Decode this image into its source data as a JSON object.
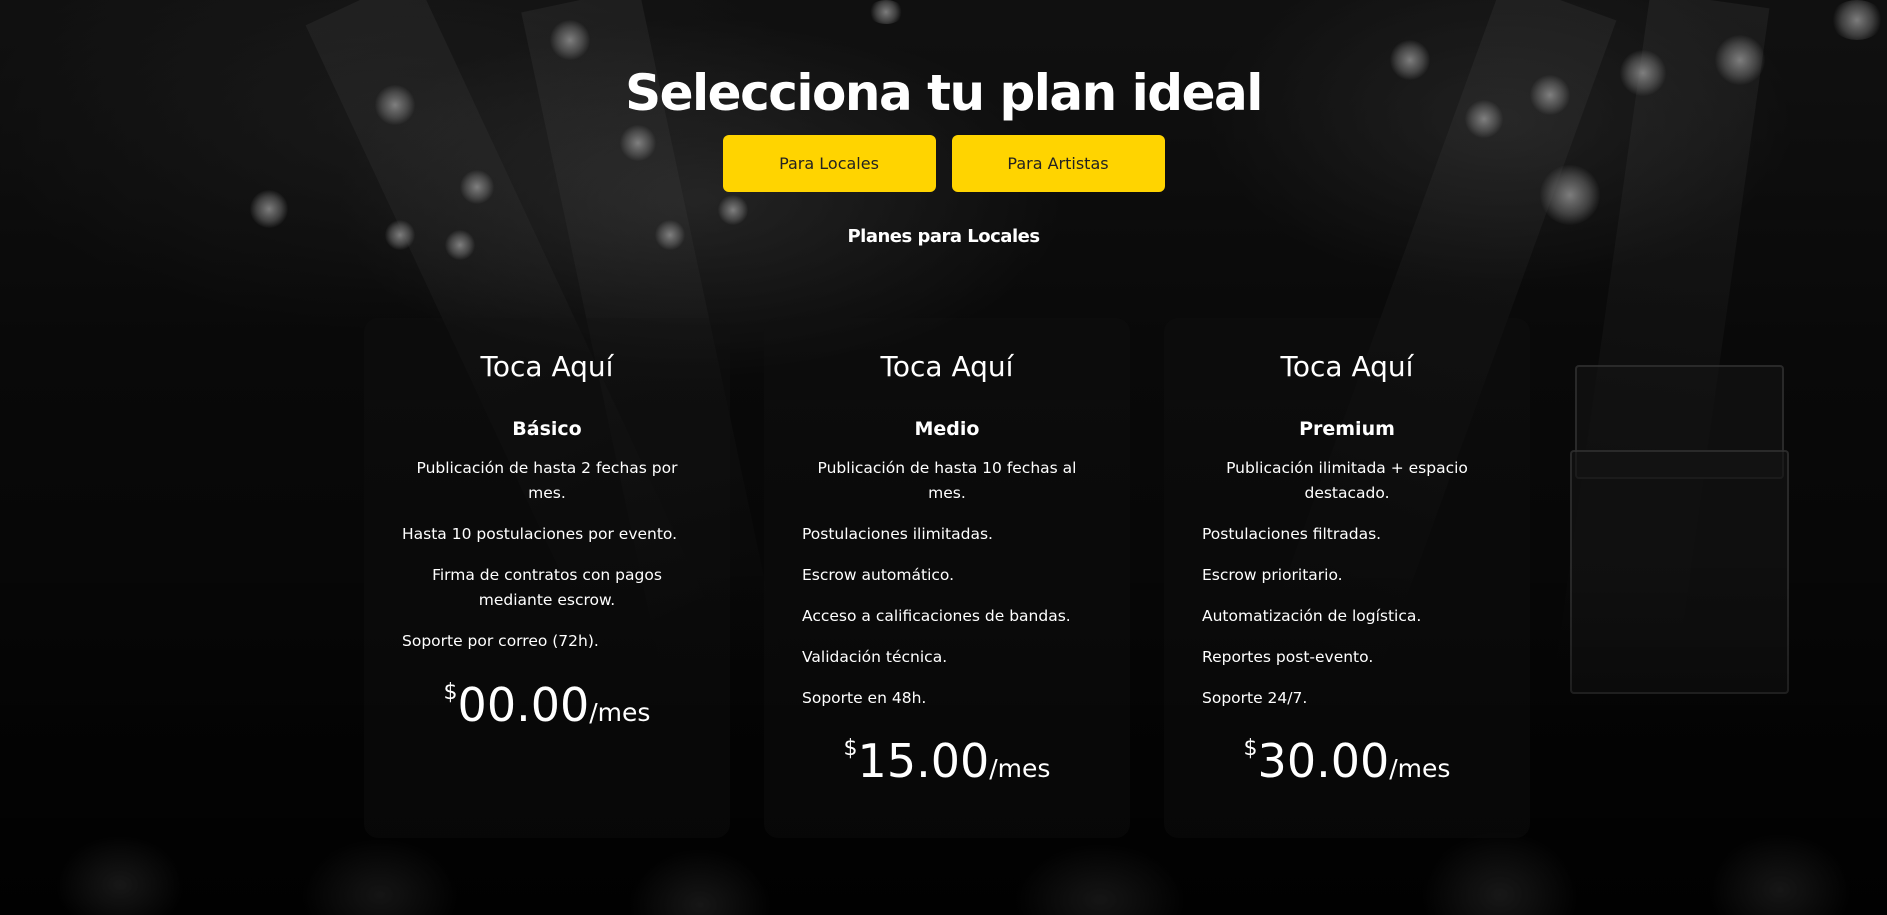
{
  "header": {
    "title": "Selecciona tu plan ideal",
    "tabs": [
      {
        "label": "Para Locales"
      },
      {
        "label": "Para Artistas"
      }
    ],
    "subtitle": "Planes para Locales"
  },
  "colors": {
    "accent": "#ffd400",
    "text": "#ffffff",
    "button_text": "#222222"
  },
  "plans": [
    {
      "brand": "Toca Aquí",
      "tier": "Básico",
      "features": [
        "Publicación de hasta 2 fechas por mes.",
        "Hasta 10 postulaciones por evento.",
        "Firma de contratos con pagos mediante escrow.",
        "Soporte por correo (72h)."
      ],
      "currency": "$",
      "price": "00.00",
      "period": "/mes"
    },
    {
      "brand": "Toca Aquí",
      "tier": "Medio",
      "features": [
        "Publicación de hasta 10 fechas al mes.",
        "Postulaciones ilimitadas.",
        "Escrow automático.",
        "Acceso a calificaciones de bandas.",
        "Validación técnica.",
        "Soporte en 48h."
      ],
      "currency": "$",
      "price": "15.00",
      "period": "/mes"
    },
    {
      "brand": "Toca Aquí",
      "tier": "Premium",
      "features": [
        "Publicación ilimitada + espacio destacado.",
        "Postulaciones filtradas.",
        "Escrow prioritario.",
        "Automatización de logística.",
        "Reportes post-evento.",
        "Soporte 24/7."
      ],
      "currency": "$",
      "price": "30.00",
      "period": "/mes"
    }
  ]
}
